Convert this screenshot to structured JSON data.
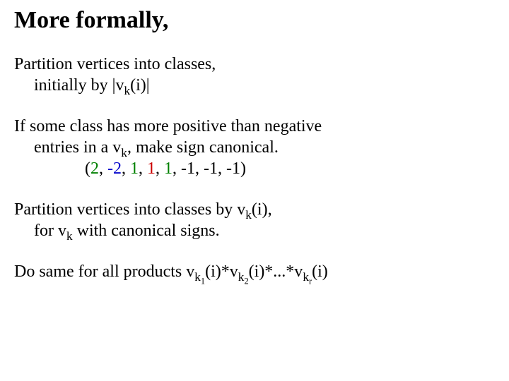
{
  "title": "More formally,",
  "p1": {
    "l1a": "Partition vertices into classes,",
    "l2a": "initially by |v",
    "l2sub": "k",
    "l2b": "(i)|"
  },
  "p2": {
    "l1": "If some class has more positive than negative",
    "l2a": "entries in a v",
    "l2sub": "k",
    "l2b": ", make sign canonical.",
    "seq": {
      "open": "(",
      "v1": "2",
      "s1": ", ",
      "v2": "-2",
      "s2": ", ",
      "v3": "1",
      "s3": ", ",
      "v4": "1",
      "s4": ", ",
      "v5": "1",
      "s5": ", ",
      "v6": "-1",
      "s6": ", ",
      "v7": "-1",
      "s7": ", ",
      "v8": "-1",
      "close": ")"
    }
  },
  "p3": {
    "l1a": "Partition vertices into classes by v",
    "l1sub": "k",
    "l1b": "(i),",
    "l2a": "for v",
    "l2sub": "k",
    "l2b": " with canonical signs."
  },
  "p4": {
    "a": "Do same for all products v",
    "s1a": "k",
    "s1b": "1",
    "b": "(i)*v",
    "s2a": "k",
    "s2b": "2",
    "c": "(i)*...*v",
    "s3a": "k",
    "s3b": "r",
    "d": "(i)"
  }
}
